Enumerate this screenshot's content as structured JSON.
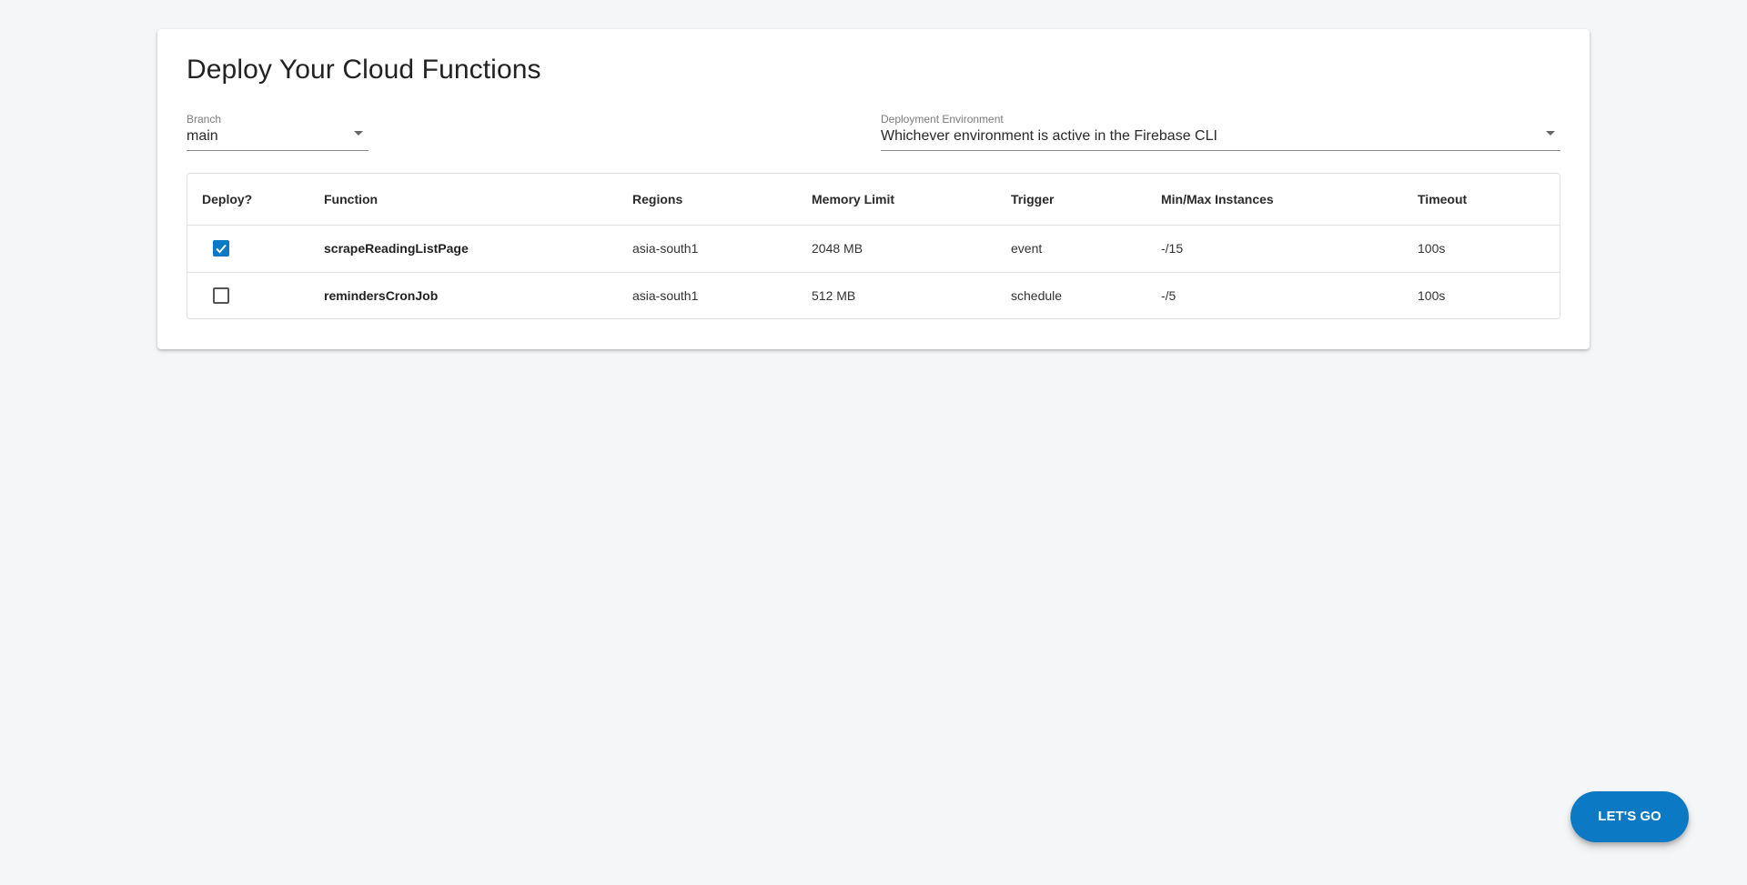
{
  "page": {
    "title": "Deploy Your Cloud Functions"
  },
  "branch": {
    "label": "Branch",
    "value": "main",
    "caret_icon": "chevron-down-icon"
  },
  "environment": {
    "label": "Deployment Environment",
    "value": "Whichever environment is active in the Firebase CLI",
    "caret_icon": "chevron-down-icon"
  },
  "table": {
    "headers": [
      "Deploy?",
      "Function",
      "Regions",
      "Memory Limit",
      "Trigger",
      "Min/Max Instances",
      "Timeout"
    ],
    "rows": [
      {
        "deploy": true,
        "function": "scrapeReadingListPage",
        "region": "asia-south1",
        "memory": "2048 MB",
        "trigger": "event",
        "instances": "-/15",
        "timeout": "100s"
      },
      {
        "deploy": false,
        "function": "remindersCronJob",
        "region": "asia-south1",
        "memory": "512 MB",
        "trigger": "schedule",
        "instances": "-/5",
        "timeout": "100s"
      }
    ]
  },
  "action": {
    "label": "LET'S GO"
  },
  "colors": {
    "accent": "#0b79c4",
    "background": "#f5f6f8",
    "card": "#ffffff"
  }
}
